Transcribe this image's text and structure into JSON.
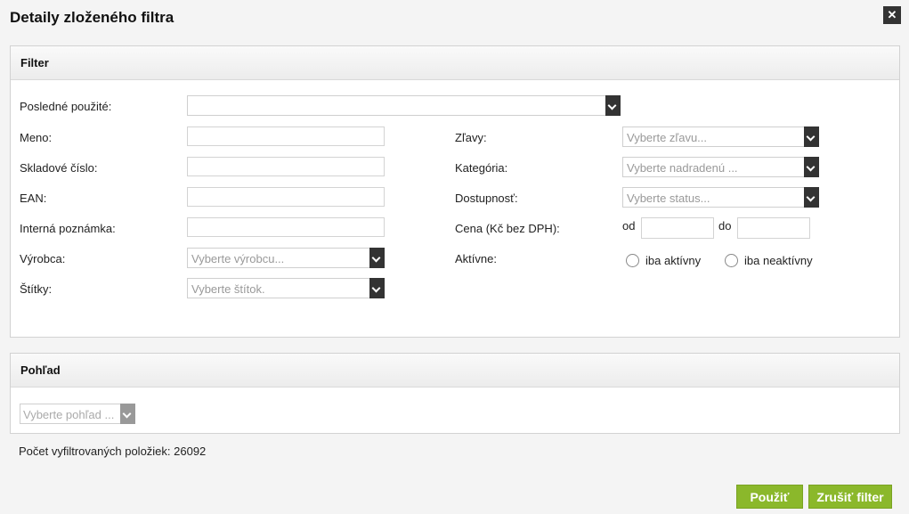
{
  "dialog": {
    "title": "Detaily zloženého filtra",
    "close_icon": "close-icon"
  },
  "filter_panel": {
    "title": "Filter",
    "last_used": {
      "label": "Posledné použité:",
      "value": ""
    },
    "name": {
      "label": "Meno:",
      "value": ""
    },
    "sku": {
      "label": "Skladové číslo:",
      "value": ""
    },
    "ean": {
      "label": "EAN:",
      "value": ""
    },
    "internal_note": {
      "label": "Interná poznámka:",
      "value": ""
    },
    "manufacturer": {
      "label": "Výrobca:",
      "placeholder": "Vyberte výrobcu..."
    },
    "tags": {
      "label": "Štítky:",
      "placeholder": "Vyberte štítok."
    },
    "discounts": {
      "label": "Zľavy:",
      "placeholder": "Vyberte zľavu..."
    },
    "category": {
      "label": "Kategória:",
      "placeholder": "Vyberte nadradenú ..."
    },
    "availability": {
      "label": "Dostupnosť:",
      "placeholder": "Vyberte status..."
    },
    "price": {
      "label": "Cena (Kč bez DPH):",
      "from_label": "od",
      "to_label": "do",
      "from_value": "",
      "to_value": ""
    },
    "active": {
      "label": "Aktívne:",
      "options": [
        "iba aktívny",
        "iba neaktívny"
      ],
      "selected": null
    }
  },
  "view_panel": {
    "title": "Pohľad",
    "view_select": {
      "placeholder": "Vyberte pohľad ..."
    }
  },
  "count": {
    "text": "Počet vyfiltrovaných položiek: 26092"
  },
  "buttons": {
    "apply": "Použiť",
    "cancel": "Zrušiť filter"
  },
  "colors": {
    "button_green": "#8bb82b",
    "arrow_dark": "#333333"
  }
}
